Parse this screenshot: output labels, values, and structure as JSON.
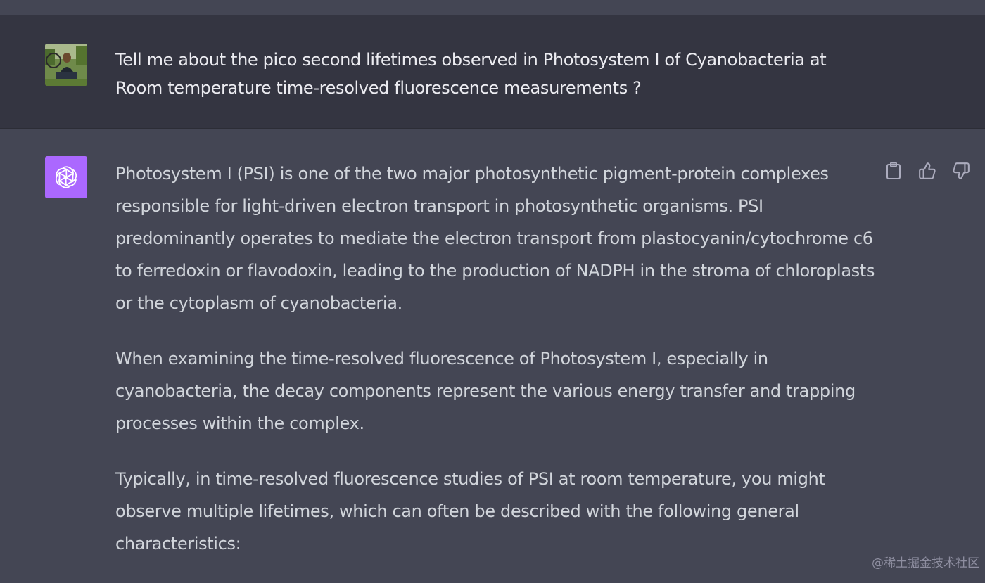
{
  "conversation": {
    "user_message": "Tell me about the pico second lifetimes observed in Photosystem I of Cyanobacteria at Room temperature time-resolved fluorescence measurements ?",
    "assistant_paragraphs": [
      "Photosystem I (PSI) is one of the two major photosynthetic pigment-protein complexes responsible for light-driven electron transport in photosynthetic organisms. PSI predominantly operates to mediate the electron transport from plastocyanin/cytochrome c6 to ferredoxin or flavodoxin, leading to the production of NADPH in the stroma of chloroplasts or the cytoplasm of cyanobacteria.",
      "When examining the time-resolved fluorescence of Photosystem I, especially in cyanobacteria, the decay components represent the various energy transfer and trapping processes within the complex.",
      "Typically, in time-resolved fluorescence studies of PSI at room temperature, you might observe multiple lifetimes, which can often be described with the following general characteristics:"
    ]
  },
  "icons": {
    "assistant_avatar": "openai-logo-icon",
    "copy": "clipboard-icon",
    "like": "thumbs-up-icon",
    "dislike": "thumbs-down-icon"
  },
  "colors": {
    "user_row_bg": "#343541",
    "assistant_row_bg": "#444654",
    "assistant_avatar_bg": "#ab68ff"
  },
  "watermark": "@稀土掘金技术社区"
}
